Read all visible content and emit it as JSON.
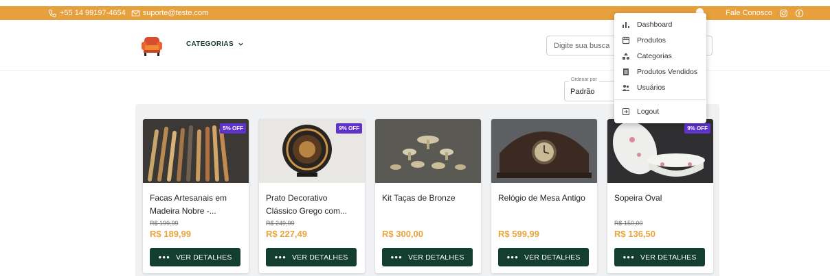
{
  "topbar": {
    "phone": "+55 14 99197-4654",
    "email": "suporte@teste.com",
    "contact": "Fale Conosco",
    "color": "#e6a03c"
  },
  "header": {
    "categories_label": "CATEGORIAS",
    "search_placeholder": "Digite sua busca"
  },
  "sort": {
    "label": "Ordenar por",
    "value": "Padrão"
  },
  "menu": {
    "items": [
      {
        "label": "Dashboard",
        "icon": "bar-chart-icon"
      },
      {
        "label": "Produtos",
        "icon": "storefront-icon"
      },
      {
        "label": "Categorias",
        "icon": "category-icon"
      },
      {
        "label": "Produtos Vendidos",
        "icon": "receipt-icon"
      },
      {
        "label": "Usuários",
        "icon": "users-icon"
      },
      {
        "label": "Logout",
        "icon": "logout-icon"
      }
    ]
  },
  "products": [
    {
      "title": "Facas Artesanais em Madeira Nobre -...",
      "old_price": "R$ 199,99",
      "price": "R$ 189,99",
      "badge": "5% OFF",
      "button": "VER DETALHES"
    },
    {
      "title": "Prato Decorativo Clássico Grego com...",
      "old_price": "R$ 249,99",
      "price": "R$ 227,49",
      "badge": "9% OFF",
      "button": "VER DETALHES"
    },
    {
      "title": "Kit Taças de Bronze",
      "old_price": "",
      "price": "R$ 300,00",
      "badge": "",
      "button": "VER DETALHES"
    },
    {
      "title": "Relógio de Mesa Antigo",
      "old_price": "",
      "price": "R$ 599,99",
      "badge": "",
      "button": "VER DETALHES"
    },
    {
      "title": "Sopeira Oval",
      "old_price": "R$ 150,00",
      "price": "R$ 136,50",
      "badge": "9% OFF",
      "button": "VER DETALHES"
    }
  ],
  "colors": {
    "accent": "#e8a33c",
    "button": "#133e30",
    "badge": "#5f33c9"
  }
}
